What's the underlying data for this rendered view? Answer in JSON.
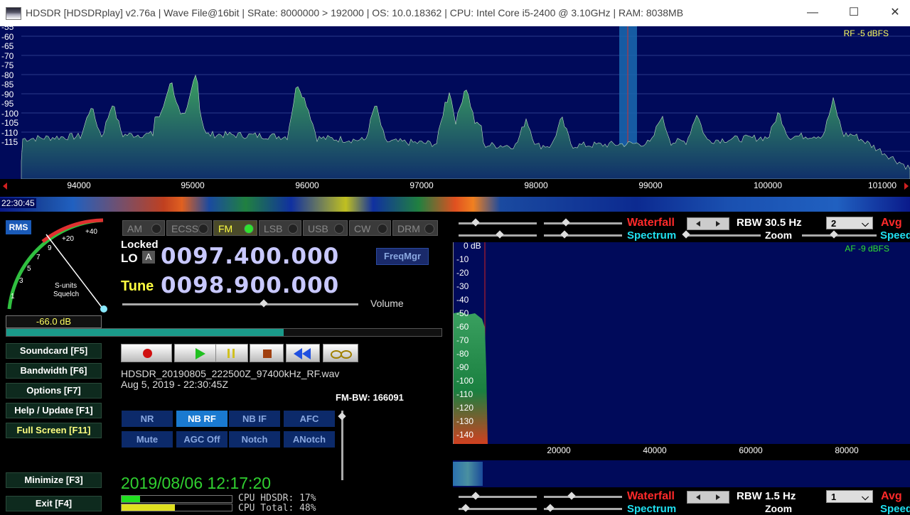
{
  "window": {
    "title": "HDSDR  [HDSDRplay]  v2.76a  |  Wave File@16bit  |  SRate: 8000000 > 192000  |  OS: 10.0.18362  |  CPU: Intel Core i5-2400 @ 3.10GHz  |  RAM: 8038MB"
  },
  "spectrum": {
    "rf_level": "RF  -5 dBFS",
    "db_labels": [
      "-55",
      "-60",
      "-65",
      "-70",
      "-75",
      "-80",
      "-85",
      "-90",
      "-95",
      "-100",
      "-105",
      "-110",
      "-115"
    ],
    "freq_labels": [
      "94000",
      "95000",
      "96000",
      "97000",
      "98000",
      "99000",
      "100000",
      "101000"
    ],
    "waterfall_time": "22:30:45"
  },
  "smeter": {
    "mode_label": "RMS",
    "scale": [
      "1",
      "3",
      "5",
      "7",
      "9",
      "+20",
      "+40"
    ],
    "caption1": "S-units",
    "caption2": "Squelch",
    "readout": "-66.0 dB"
  },
  "modes": [
    {
      "label": "AM",
      "active": false
    },
    {
      "label": "ECSS",
      "active": false
    },
    {
      "label": "FM",
      "active": true
    },
    {
      "label": "LSB",
      "active": false
    },
    {
      "label": "USB",
      "active": false
    },
    {
      "label": "CW",
      "active": false
    },
    {
      "label": "DRM",
      "active": false
    }
  ],
  "tuning": {
    "locked": "Locked",
    "lo_label": "LO",
    "lo_button": "A",
    "lo_freq": "0097.400.000",
    "tune_label": "Tune",
    "tune_freq": "0098.900.000",
    "freqmgr": "FreqMgr",
    "volume_label": "Volume",
    "volume_level": 0.6,
    "fm_bw": "FM-BW: 166091"
  },
  "left_buttons": [
    {
      "label": "Soundcard  [F5]"
    },
    {
      "label": "Bandwidth  [F6]"
    },
    {
      "label": "Options   [F7]"
    },
    {
      "label": "Help / Update  [F1]"
    },
    {
      "label": "Full Screen  [F11]"
    },
    {
      "label": "Minimize  [F3]"
    },
    {
      "label": "Exit       [F4]"
    }
  ],
  "playback": {
    "filename": "HDSDR_20190805_222500Z_97400kHz_RF.wav",
    "filedate": "Aug 5, 2019 - 22:30:45Z",
    "progress": 0.6
  },
  "dsp": {
    "row1": [
      {
        "label": "NR",
        "on": false
      },
      {
        "label": "NB RF",
        "on": true
      },
      {
        "label": "NB IF",
        "on": false
      },
      {
        "label": "AFC",
        "on": false
      }
    ],
    "row2": [
      {
        "label": "Mute",
        "on": false
      },
      {
        "label": "AGC Off",
        "on": false
      },
      {
        "label": "Notch",
        "on": false
      },
      {
        "label": "ANotch",
        "on": false
      }
    ]
  },
  "status": {
    "datetime": "2019/08/06 12:17:20",
    "cpu_hdsdr": "CPU HDSDR:  17%",
    "cpu_total": "CPU Total:  48%"
  },
  "top_controls": {
    "waterfall": "Waterfall",
    "spectrum": "Spectrum",
    "rbw": "RBW 30.5 Hz",
    "avg_value": "2",
    "avg": "Avg",
    "zoom": "Zoom",
    "speed": "Speed"
  },
  "audio": {
    "af_level": "AF  -9 dBFS",
    "db_labels": [
      "0 dB",
      "-10",
      "-20",
      "-30",
      "-40",
      "-50",
      "-60",
      "-70",
      "-80",
      "-90",
      "-100",
      "-110",
      "-120",
      "-130",
      "-140"
    ],
    "freq_labels": [
      "20000",
      "40000",
      "60000",
      "80000"
    ]
  },
  "bottom_controls": {
    "waterfall": "Waterfall",
    "spectrum": "Spectrum",
    "rbw": "RBW  1.5 Hz",
    "avg_value": "1",
    "avg": "Avg",
    "zoom": "Zoom",
    "speed": "Speed"
  },
  "colors": {
    "spectrum_bg": "#000a5a",
    "trace": "#2a7a4a",
    "active_mode": "#ffff40",
    "dsp_on": "#1a7ad0",
    "red_label": "#ff2a2a",
    "cyan_label": "#20e0f0"
  }
}
